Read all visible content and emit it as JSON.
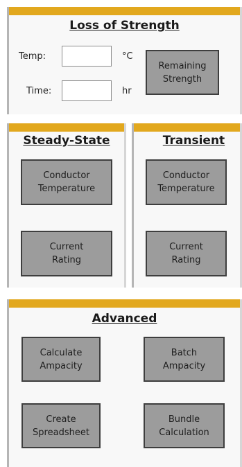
{
  "colors": {
    "accent": "#e2a81e",
    "button_bg": "#9c9c9c",
    "button_border": "#3e3e3e"
  },
  "loss": {
    "title": "Loss of Strength",
    "temp_label": "Temp:",
    "temp_value": "",
    "temp_unit": "°C",
    "time_label": "Time:",
    "time_value": "",
    "time_unit": "hr",
    "remaining_btn": "Remaining\nStrength"
  },
  "steady": {
    "title": "Steady-State",
    "conductor_btn": "Conductor\nTemperature",
    "current_btn": "Current\nRating"
  },
  "transient": {
    "title": "Transient",
    "conductor_btn": "Conductor\nTemperature",
    "current_btn": "Current\nRating"
  },
  "advanced": {
    "title": "Advanced",
    "calc_btn": "Calculate\nAmpacity",
    "batch_btn": "Batch\nAmpacity",
    "spreadsheet_btn": "Create\nSpreadsheet",
    "bundle_btn": "Bundle\nCalculation"
  }
}
